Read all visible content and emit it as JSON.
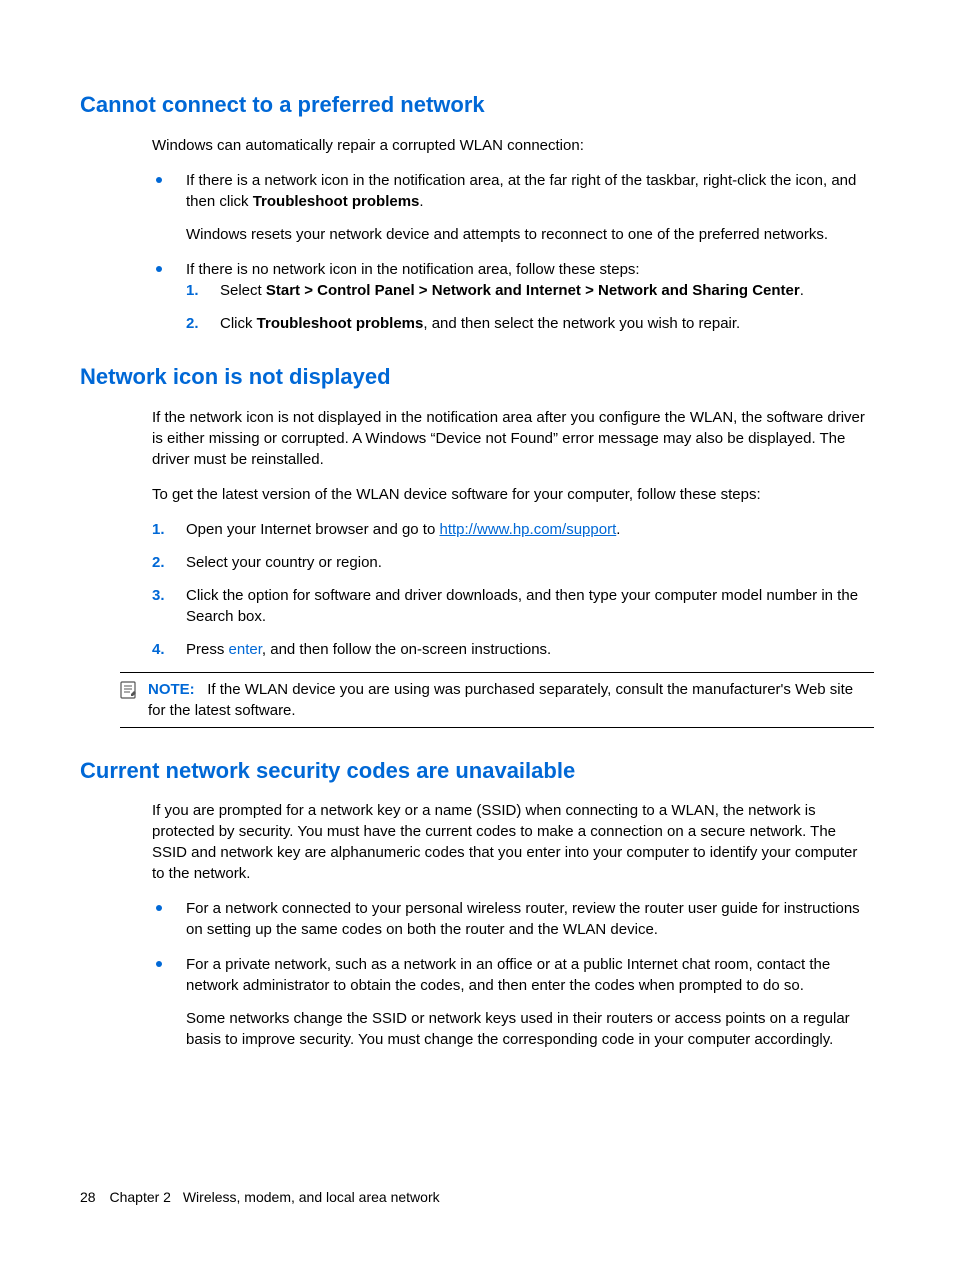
{
  "section1": {
    "heading": "Cannot connect to a preferred network",
    "intro": "Windows can automatically repair a corrupted WLAN connection:",
    "bullet1_pre": "If there is a network icon in the notification area, at the far right of the taskbar, right-click the icon, and then click ",
    "bullet1_bold": "Troubleshoot problems",
    "bullet1_post": ".",
    "bullet1_follow": "Windows resets your network device and attempts to reconnect to one of the preferred networks.",
    "bullet2_text": "If there is no network icon in the notification area, follow these steps:",
    "step1_pre": "Select ",
    "step1_bold": "Start > Control Panel > Network and Internet > Network and Sharing Center",
    "step1_post": ".",
    "step2_pre": "Click ",
    "step2_bold": "Troubleshoot problems",
    "step2_post": ", and then select the network you wish to repair."
  },
  "section2": {
    "heading": "Network icon is not displayed",
    "para1": "If the network icon is not displayed in the notification area after you configure the WLAN, the software driver is either missing or corrupted. A Windows “Device not Found” error message may also be displayed. The driver must be reinstalled.",
    "para2": "To get the latest version of the WLAN device software for your computer, follow these steps:",
    "step1_pre": "Open your Internet browser and go to ",
    "step1_link": "http://www.hp.com/support",
    "step1_post": ".",
    "step2": "Select your country or region.",
    "step3": "Click the option for software and driver downloads, and then type your computer model number in the Search box.",
    "step4_pre": "Press ",
    "step4_key": "enter",
    "step4_post": ", and then follow the on-screen instructions.",
    "note_label": "NOTE:",
    "note_text": "If the WLAN device you are using was purchased separately, consult the manufacturer's Web site for the latest software."
  },
  "section3": {
    "heading": "Current network security codes are unavailable",
    "para1": "If you are prompted for a network key or a name (SSID) when connecting to a WLAN, the network is protected by security. You must have the current codes to make a connection on a secure network. The SSID and network key are alphanumeric codes that you enter into your computer to identify your computer to the network.",
    "bullet1": "For a network connected to your personal wireless router, review the router user guide for instructions on setting up the same codes on both the router and the WLAN device.",
    "bullet2": "For a private network, such as a network in an office or at a public Internet chat room, contact the network administrator to obtain the codes, and then enter the codes when prompted to do so.",
    "bullet2_follow": "Some networks change the SSID or network keys used in their routers or access points on a regular basis to improve security. You must change the corresponding code in your computer accordingly."
  },
  "footer": {
    "page_number": "28",
    "chapter_label": "Chapter 2",
    "chapter_title": "Wireless, modem, and local area network"
  }
}
